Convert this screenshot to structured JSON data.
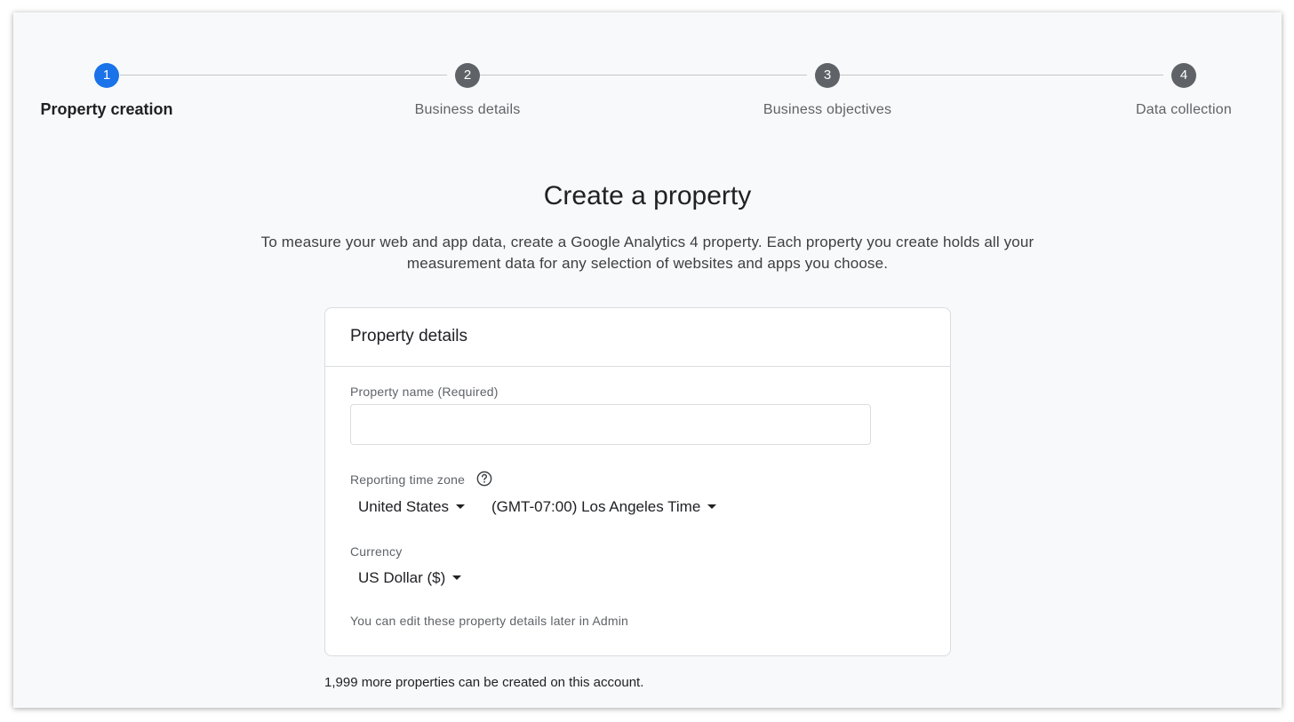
{
  "stepper": {
    "steps": [
      {
        "number": "1",
        "label": "Property creation",
        "state": "active"
      },
      {
        "number": "2",
        "label": "Business details",
        "state": "inactive"
      },
      {
        "number": "3",
        "label": "Business objectives",
        "state": "inactive"
      },
      {
        "number": "4",
        "label": "Data collection",
        "state": "inactive"
      }
    ]
  },
  "header": {
    "title": "Create a property",
    "subtitle": "To measure your web and app data, create a Google Analytics 4 property. Each property you create holds all your measurement data for any selection of websites and apps you choose."
  },
  "card": {
    "title": "Property details",
    "property_name": {
      "label": "Property name (Required)",
      "value": "",
      "placeholder": ""
    },
    "time_zone": {
      "label": "Reporting time zone",
      "help_icon": "help-circle-icon",
      "country": "United States",
      "zone": "(GMT-07:00) Los Angeles Time"
    },
    "currency": {
      "label": "Currency",
      "value": "US Dollar ($)"
    },
    "footnote": "You can edit these property details later in Admin"
  },
  "quota_note": "1,999 more properties can be created on this account.",
  "colors": {
    "accent": "#1a73e8",
    "step_inactive": "#5f6368",
    "background": "#f8f9fa",
    "border": "#dadce0"
  }
}
